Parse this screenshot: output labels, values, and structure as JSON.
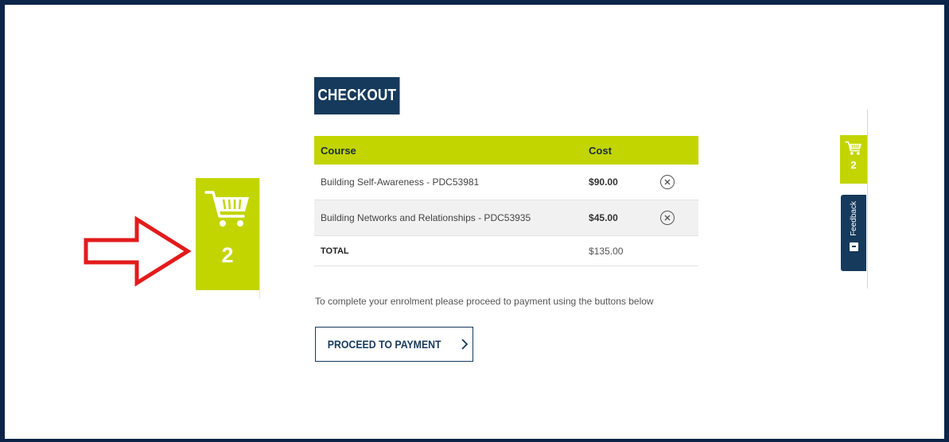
{
  "checkout": {
    "title": "CHECKOUT"
  },
  "table": {
    "headers": {
      "course": "Course",
      "cost": "Cost"
    },
    "rows": [
      {
        "course": "Building Self-Awareness - PDC53981",
        "cost": "$90.00"
      },
      {
        "course": "Building Networks and Relationships - PDC53935",
        "cost": "$45.00"
      }
    ],
    "total": {
      "label": "TOTAL",
      "cost": "$135.00"
    },
    "remove_icon": "circle-x-icon"
  },
  "instructions": "To complete your enrolment please proceed to payment using the buttons below",
  "proceed": {
    "label": "PROCEED TO PAYMENT",
    "icon": "chevron-right-icon"
  },
  "cart_widget": {
    "count": "2",
    "icon": "shopping-cart-icon"
  },
  "side_cart": {
    "count": "2",
    "icon": "shopping-cart-icon"
  },
  "feedback": {
    "label": "Feedback",
    "icon": "comment-icon"
  },
  "annotation": {
    "icon": "right-arrow-outline-icon",
    "color": "#e31b1b"
  },
  "colors": {
    "accent": "#c2d500",
    "navy": "#163a5c",
    "frame": "#0b2447"
  }
}
